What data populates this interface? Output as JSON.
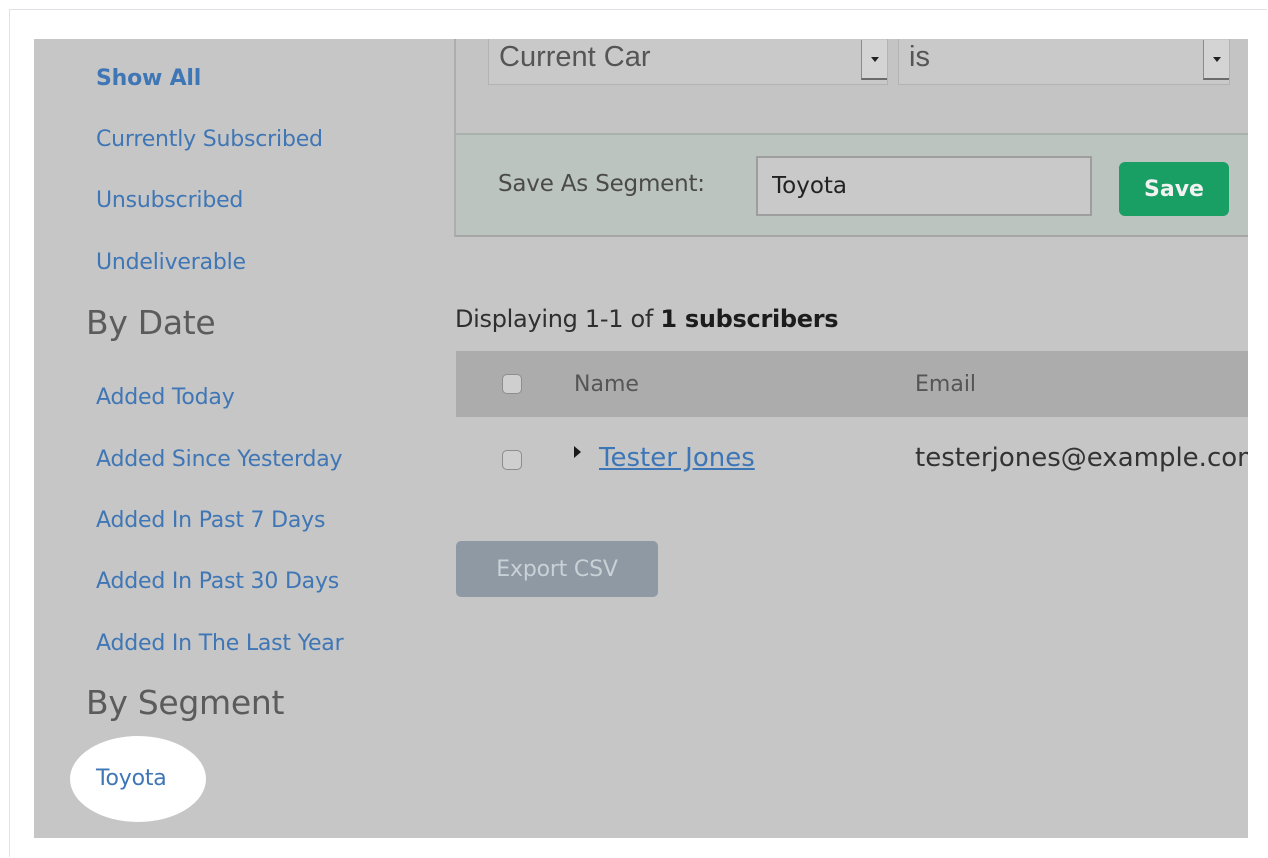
{
  "sidebar": {
    "status_links": [
      "Show All",
      "Currently Subscribed",
      "Unsubscribed",
      "Undeliverable"
    ],
    "by_date_heading": "By Date",
    "date_links": [
      "Added Today",
      "Added Since Yesterday",
      "Added In Past 7 Days",
      "Added In Past 30 Days",
      "Added In The Last Year"
    ],
    "by_segment_heading": "By Segment",
    "segment_links": [
      "Toyota"
    ]
  },
  "filter": {
    "field_value": "Current Car",
    "operator_value": "is"
  },
  "segment": {
    "label": "Save As Segment:",
    "input_value": "Toyota",
    "save_label": "Save"
  },
  "results": {
    "prefix": "Displaying 1-1 of",
    "count_bold": "1 subscribers"
  },
  "table": {
    "columns": [
      "Name",
      "Email"
    ],
    "rows": [
      {
        "name": "Tester Jones",
        "email": "testerjones@example.com"
      }
    ]
  },
  "actions": {
    "export_label": "Export CSV"
  },
  "colors": {
    "link": "#3f76b5",
    "save_button": "#199e64",
    "export_button": "#8e99a4",
    "backdrop": "#c6c6c6"
  }
}
